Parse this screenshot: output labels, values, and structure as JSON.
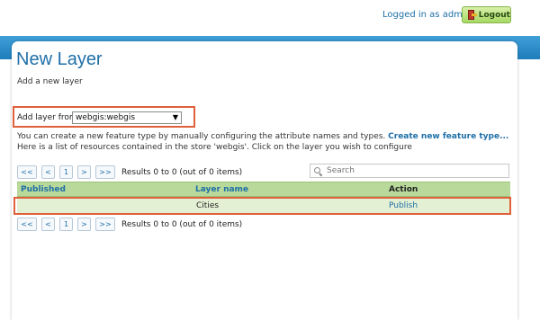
{
  "header": {
    "logged_in_text": "Logged in as admin.",
    "logout_label": "Logout"
  },
  "page": {
    "title": "New Layer",
    "subtitle": "Add a new layer"
  },
  "add_layer": {
    "label": "Add layer from",
    "selected_store": "webgis:webgis"
  },
  "description": {
    "line1_text": "You can create a new feature type by manually configuring the attribute names and types.",
    "create_link": "Create new feature type...",
    "line2_text": "Here is a list of resources contained in the store 'webgis'. Click on the layer you wish to configure"
  },
  "pager": {
    "first": "<<",
    "prev": "<",
    "page": "1",
    "next": ">",
    "last": ">>",
    "results": "Results 0 to 0 (out of 0 items)"
  },
  "search": {
    "placeholder": "Search"
  },
  "table": {
    "columns": [
      "Published",
      "Layer name",
      "Action"
    ],
    "rows": [
      {
        "published": "",
        "layer_name": "Cities",
        "action": "Publish"
      }
    ]
  },
  "colors": {
    "accent": "#1e6fa8",
    "header_bar": "#2b8ac8",
    "table_header_bg": "#b8d99a",
    "row_bg": "#e4f0d4",
    "highlight_outline": "#e0603a",
    "logout_button": "#a6d864"
  }
}
